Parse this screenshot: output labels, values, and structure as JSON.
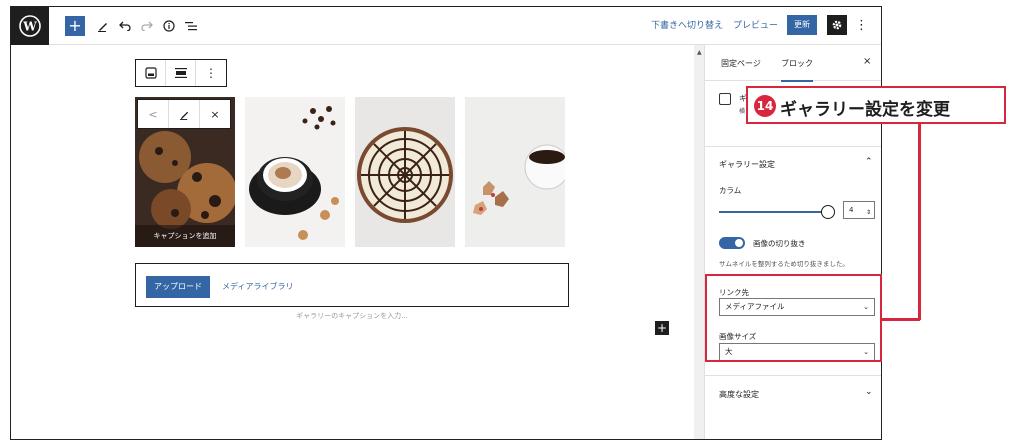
{
  "colors": {
    "accent": "#3465a4",
    "annotation_red": "#d7263d",
    "dark": "#1e1e1e"
  },
  "topbar": {
    "logo_icon": "wordpress-icon",
    "add_icon": "+",
    "edit_icon": "pencil-icon",
    "undo_icon": "undo-icon",
    "redo_icon": "redo-icon",
    "info_icon": "info-icon",
    "list_icon": "list-view-icon",
    "save_draft": "下書きへ切り替え",
    "preview": "プレビュー",
    "update": "更新",
    "settings_icon": "gear-icon",
    "more_icon": "⋮"
  },
  "canvas": {
    "block_toolbar": [
      "gallery-icon",
      "align-icon",
      "more-icon"
    ],
    "images": [
      {
        "name": "cookies",
        "caption": "キャプションを追加"
      },
      {
        "name": "coffee-cup",
        "caption": ""
      },
      {
        "name": "spiderweb-cake",
        "caption": ""
      },
      {
        "name": "coffee-and-cookies",
        "caption": ""
      }
    ],
    "image_toolbar": [
      "<",
      "pencil-icon",
      "×"
    ],
    "upload_button": "アップロード",
    "media_library": "メディアライブラリ",
    "gallery_caption_placeholder": "ギャラリーのキャプションを入力..."
  },
  "sidebar": {
    "tabs": [
      "固定ページ",
      "ブロック"
    ],
    "active_tab": "ブロック",
    "close": "×",
    "block_title": "ギ",
    "block_desc": "横\n表",
    "gallery_settings": "ギャラリー設定",
    "columns_label": "カラム",
    "columns_value": "4",
    "crop_label": "画像の切り抜き",
    "crop_enabled": true,
    "crop_help": "サムネイルを整列するため切り抜きました。",
    "link_label": "リンク先",
    "link_value": "メディアファイル",
    "size_label": "画像サイズ",
    "size_value": "大",
    "advanced": "高度な設定"
  },
  "annotation": {
    "number": "14",
    "text": "ギャラリー設定を変更"
  }
}
